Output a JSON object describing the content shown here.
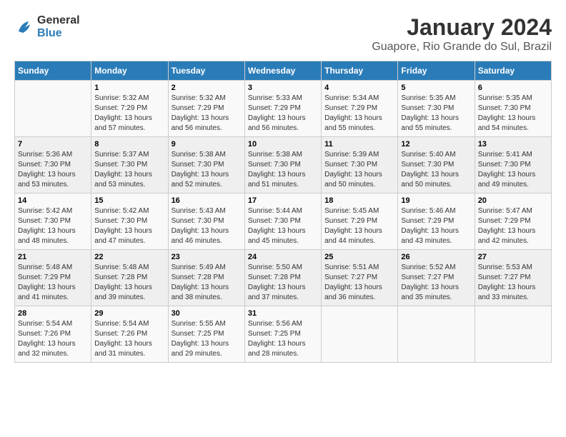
{
  "logo": {
    "general": "General",
    "blue": "Blue"
  },
  "title": "January 2024",
  "subtitle": "Guapore, Rio Grande do Sul, Brazil",
  "weekdays": [
    "Sunday",
    "Monday",
    "Tuesday",
    "Wednesday",
    "Thursday",
    "Friday",
    "Saturday"
  ],
  "weeks": [
    [
      {
        "day": "",
        "sunrise": "",
        "sunset": "",
        "daylight": ""
      },
      {
        "day": "1",
        "sunrise": "Sunrise: 5:32 AM",
        "sunset": "Sunset: 7:29 PM",
        "daylight": "Daylight: 13 hours and 57 minutes."
      },
      {
        "day": "2",
        "sunrise": "Sunrise: 5:32 AM",
        "sunset": "Sunset: 7:29 PM",
        "daylight": "Daylight: 13 hours and 56 minutes."
      },
      {
        "day": "3",
        "sunrise": "Sunrise: 5:33 AM",
        "sunset": "Sunset: 7:29 PM",
        "daylight": "Daylight: 13 hours and 56 minutes."
      },
      {
        "day": "4",
        "sunrise": "Sunrise: 5:34 AM",
        "sunset": "Sunset: 7:29 PM",
        "daylight": "Daylight: 13 hours and 55 minutes."
      },
      {
        "day": "5",
        "sunrise": "Sunrise: 5:35 AM",
        "sunset": "Sunset: 7:30 PM",
        "daylight": "Daylight: 13 hours and 55 minutes."
      },
      {
        "day": "6",
        "sunrise": "Sunrise: 5:35 AM",
        "sunset": "Sunset: 7:30 PM",
        "daylight": "Daylight: 13 hours and 54 minutes."
      }
    ],
    [
      {
        "day": "7",
        "sunrise": "Sunrise: 5:36 AM",
        "sunset": "Sunset: 7:30 PM",
        "daylight": "Daylight: 13 hours and 53 minutes."
      },
      {
        "day": "8",
        "sunrise": "Sunrise: 5:37 AM",
        "sunset": "Sunset: 7:30 PM",
        "daylight": "Daylight: 13 hours and 53 minutes."
      },
      {
        "day": "9",
        "sunrise": "Sunrise: 5:38 AM",
        "sunset": "Sunset: 7:30 PM",
        "daylight": "Daylight: 13 hours and 52 minutes."
      },
      {
        "day": "10",
        "sunrise": "Sunrise: 5:38 AM",
        "sunset": "Sunset: 7:30 PM",
        "daylight": "Daylight: 13 hours and 51 minutes."
      },
      {
        "day": "11",
        "sunrise": "Sunrise: 5:39 AM",
        "sunset": "Sunset: 7:30 PM",
        "daylight": "Daylight: 13 hours and 50 minutes."
      },
      {
        "day": "12",
        "sunrise": "Sunrise: 5:40 AM",
        "sunset": "Sunset: 7:30 PM",
        "daylight": "Daylight: 13 hours and 50 minutes."
      },
      {
        "day": "13",
        "sunrise": "Sunrise: 5:41 AM",
        "sunset": "Sunset: 7:30 PM",
        "daylight": "Daylight: 13 hours and 49 minutes."
      }
    ],
    [
      {
        "day": "14",
        "sunrise": "Sunrise: 5:42 AM",
        "sunset": "Sunset: 7:30 PM",
        "daylight": "Daylight: 13 hours and 48 minutes."
      },
      {
        "day": "15",
        "sunrise": "Sunrise: 5:42 AM",
        "sunset": "Sunset: 7:30 PM",
        "daylight": "Daylight: 13 hours and 47 minutes."
      },
      {
        "day": "16",
        "sunrise": "Sunrise: 5:43 AM",
        "sunset": "Sunset: 7:30 PM",
        "daylight": "Daylight: 13 hours and 46 minutes."
      },
      {
        "day": "17",
        "sunrise": "Sunrise: 5:44 AM",
        "sunset": "Sunset: 7:30 PM",
        "daylight": "Daylight: 13 hours and 45 minutes."
      },
      {
        "day": "18",
        "sunrise": "Sunrise: 5:45 AM",
        "sunset": "Sunset: 7:29 PM",
        "daylight": "Daylight: 13 hours and 44 minutes."
      },
      {
        "day": "19",
        "sunrise": "Sunrise: 5:46 AM",
        "sunset": "Sunset: 7:29 PM",
        "daylight": "Daylight: 13 hours and 43 minutes."
      },
      {
        "day": "20",
        "sunrise": "Sunrise: 5:47 AM",
        "sunset": "Sunset: 7:29 PM",
        "daylight": "Daylight: 13 hours and 42 minutes."
      }
    ],
    [
      {
        "day": "21",
        "sunrise": "Sunrise: 5:48 AM",
        "sunset": "Sunset: 7:29 PM",
        "daylight": "Daylight: 13 hours and 41 minutes."
      },
      {
        "day": "22",
        "sunrise": "Sunrise: 5:48 AM",
        "sunset": "Sunset: 7:28 PM",
        "daylight": "Daylight: 13 hours and 39 minutes."
      },
      {
        "day": "23",
        "sunrise": "Sunrise: 5:49 AM",
        "sunset": "Sunset: 7:28 PM",
        "daylight": "Daylight: 13 hours and 38 minutes."
      },
      {
        "day": "24",
        "sunrise": "Sunrise: 5:50 AM",
        "sunset": "Sunset: 7:28 PM",
        "daylight": "Daylight: 13 hours and 37 minutes."
      },
      {
        "day": "25",
        "sunrise": "Sunrise: 5:51 AM",
        "sunset": "Sunset: 7:27 PM",
        "daylight": "Daylight: 13 hours and 36 minutes."
      },
      {
        "day": "26",
        "sunrise": "Sunrise: 5:52 AM",
        "sunset": "Sunset: 7:27 PM",
        "daylight": "Daylight: 13 hours and 35 minutes."
      },
      {
        "day": "27",
        "sunrise": "Sunrise: 5:53 AM",
        "sunset": "Sunset: 7:27 PM",
        "daylight": "Daylight: 13 hours and 33 minutes."
      }
    ],
    [
      {
        "day": "28",
        "sunrise": "Sunrise: 5:54 AM",
        "sunset": "Sunset: 7:26 PM",
        "daylight": "Daylight: 13 hours and 32 minutes."
      },
      {
        "day": "29",
        "sunrise": "Sunrise: 5:54 AM",
        "sunset": "Sunset: 7:26 PM",
        "daylight": "Daylight: 13 hours and 31 minutes."
      },
      {
        "day": "30",
        "sunrise": "Sunrise: 5:55 AM",
        "sunset": "Sunset: 7:25 PM",
        "daylight": "Daylight: 13 hours and 29 minutes."
      },
      {
        "day": "31",
        "sunrise": "Sunrise: 5:56 AM",
        "sunset": "Sunset: 7:25 PM",
        "daylight": "Daylight: 13 hours and 28 minutes."
      },
      {
        "day": "",
        "sunrise": "",
        "sunset": "",
        "daylight": ""
      },
      {
        "day": "",
        "sunrise": "",
        "sunset": "",
        "daylight": ""
      },
      {
        "day": "",
        "sunrise": "",
        "sunset": "",
        "daylight": ""
      }
    ]
  ]
}
